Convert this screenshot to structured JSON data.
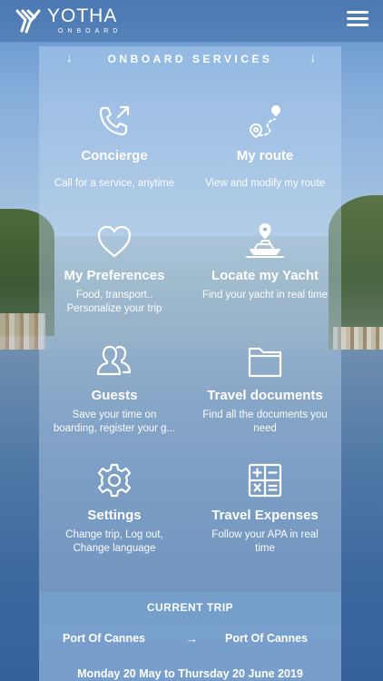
{
  "header": {
    "logo_name": "YOTHA",
    "logo_sub": "ONBOARD",
    "menu_icon": "hamburger-menu-icon"
  },
  "panel": {
    "title": "ONBOARD SERVICES"
  },
  "tiles": [
    {
      "icon": "phone-call-icon",
      "title": "Concierge",
      "desc": "Call for a service, anytime"
    },
    {
      "icon": "route-pin-icon",
      "title": "My route",
      "desc": "View and modify my route"
    },
    {
      "icon": "heart-icon",
      "title": "My Preferences",
      "desc": "Food, transport.. Personalize your trip"
    },
    {
      "icon": "yacht-location-icon",
      "title": "Locate my Yacht",
      "desc": "Find your yacht in real time"
    },
    {
      "icon": "guests-icon",
      "title": "Guests",
      "desc": "Save your time on boarding, register your g..."
    },
    {
      "icon": "folder-icon",
      "title": "Travel documents",
      "desc": "Find all the documents you need"
    },
    {
      "icon": "gear-icon",
      "title": "Settings",
      "desc": "Change trip, Log out, Change language"
    },
    {
      "icon": "calculator-icon",
      "title": "Travel Expenses",
      "desc": "Follow your APA in real time"
    }
  ],
  "current_trip": {
    "label": "CURRENT TRIP",
    "from": "Port Of Cannes",
    "to": "Port Of Cannes",
    "dates": "Monday 20 May to Thursday 20 June 2019"
  }
}
